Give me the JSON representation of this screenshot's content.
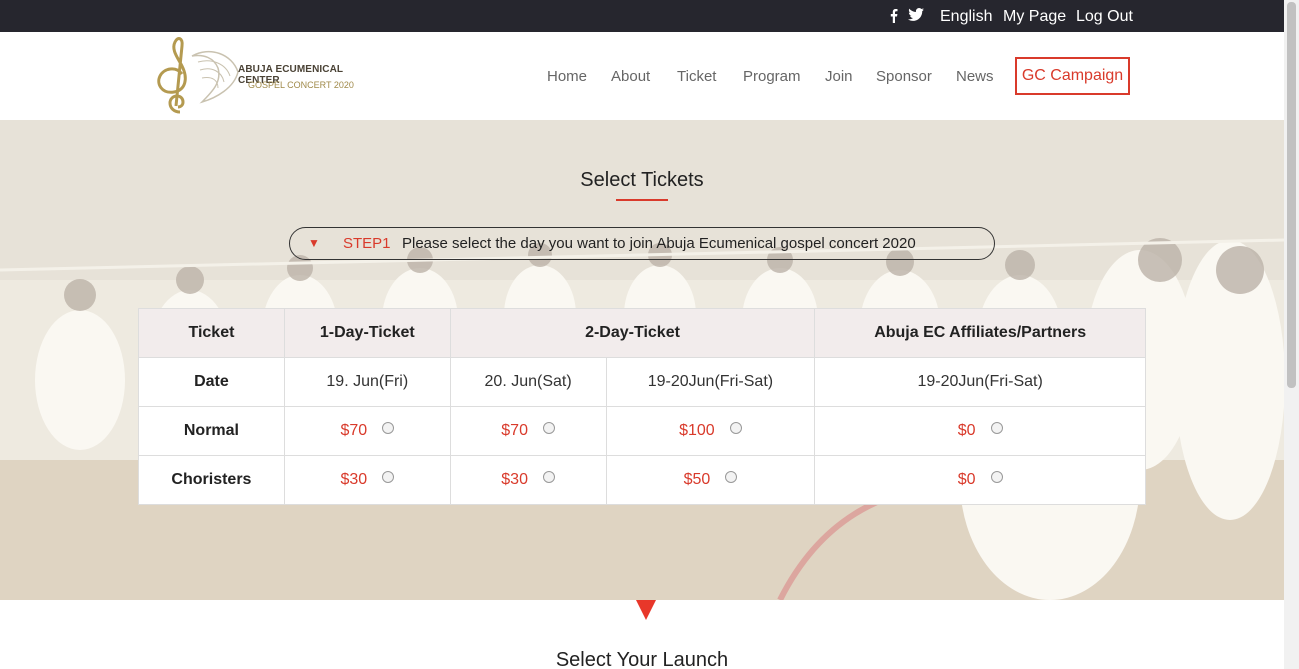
{
  "topbar": {
    "social": [
      {
        "icon": "facebook-icon",
        "glyph": "f"
      },
      {
        "icon": "twitter-icon",
        "glyph": "t"
      }
    ],
    "language": "English",
    "my_page": "My Page",
    "logout": "Log Out"
  },
  "header": {
    "logo": {
      "line1": "ABUJA ECUMENICAL CENTER",
      "line2": "GOSPEL CONCERT 2020"
    },
    "nav": [
      "Home",
      "About",
      "Ticket",
      "Program",
      "Join",
      "Sponsor",
      "News"
    ],
    "cta": "GC Campaign"
  },
  "hero": {
    "title": "Select Tickets",
    "step": {
      "label": "STEP1",
      "text": "Please select the day you want to join Abuja Ecumenical gospel concert 2020"
    }
  },
  "ticket_table": {
    "headers": [
      "Ticket",
      "1-Day-Ticket",
      "2-Day-Ticket",
      "Abuja EC Affiliates/Partners"
    ],
    "date_row": {
      "label": "Date",
      "cells": [
        "19. Jun(Fri)",
        "20. Jun(Sat)",
        "19-20Jun(Fri-Sat)",
        "19-20Jun(Fri-Sat)"
      ]
    },
    "normal_row": {
      "label": "Normal",
      "prices": [
        "$70",
        "$70",
        "$100",
        "$0"
      ]
    },
    "choristers_row": {
      "label": "Choristers",
      "prices": [
        "$30",
        "$30",
        "$50",
        "$0"
      ]
    }
  },
  "next_section": {
    "title": "Select Your Launch"
  },
  "colors": {
    "accent": "#d93a2b",
    "topbar": "#26262e"
  }
}
